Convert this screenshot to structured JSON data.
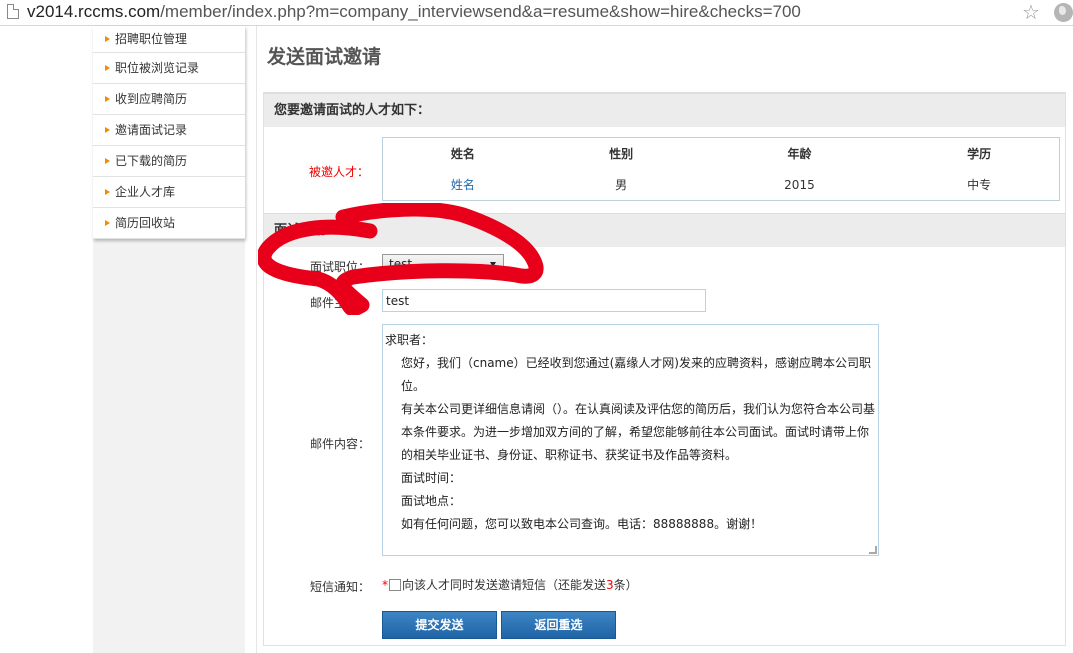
{
  "address_bar": {
    "host": "v2014.rccms.com",
    "path": "/member/index.php?m=company_interviewsend&a=resume&show=hire&checks=700"
  },
  "sidebar": {
    "items": [
      {
        "label": "招聘职位管理"
      },
      {
        "label": "职位被浏览记录"
      },
      {
        "label": "收到应聘简历"
      },
      {
        "label": "邀请面试记录"
      },
      {
        "label": "已下载的简历"
      },
      {
        "label": "企业人才库"
      },
      {
        "label": "简历回收站"
      }
    ]
  },
  "main": {
    "title": "发送面试邀请",
    "section1_title": "您要邀请面试的人才如下：",
    "invited_label": "被邀人才：",
    "table": {
      "headers": [
        "姓名",
        "性别",
        "年龄",
        "学历"
      ],
      "rows": [
        [
          "姓名",
          "男",
          "2015",
          "中专"
        ]
      ]
    },
    "section2_title": "面试邀请：",
    "position_label": "面试职位：",
    "position_value": "test",
    "mail_subject_label": "邮件主题：",
    "mail_subject_value": "test",
    "mail_content_label": "邮件内容：",
    "mail_content": {
      "greeting": "求职者：",
      "p1": "您好，我们（cname）已经收到您通过(嘉缘人才网)发来的应聘资料，感谢应聘本公司职位。",
      "p2": "有关本公司更详细信息请阅（）。在认真阅读及评估您的简历后，我们认为您符合本公司基本条件要求。为进一步增加双方间的了解，希望您能够前往本公司面试。面试时请带上你的相关毕业证书、身份证、职称证书、获奖证书及作品等资料。",
      "time": "面试时间：",
      "place": "面试地点：",
      "closing": "如有任何问题，您可以致电本公司查询。电话：88888888。谢谢！"
    },
    "sms_label": "短信通知：",
    "sms_required": "*",
    "sms_text_before": "向该人才同时发送邀请短信（还能发送",
    "sms_count": "3",
    "sms_text_after": "条）",
    "submit_label": "提交发送",
    "back_label": "返回重选"
  },
  "colors": {
    "accent_button": "#2a72b5",
    "sidebar_arrow": "#f58a00",
    "required_red": "#e00000",
    "annotation_red": "#e8001a"
  }
}
